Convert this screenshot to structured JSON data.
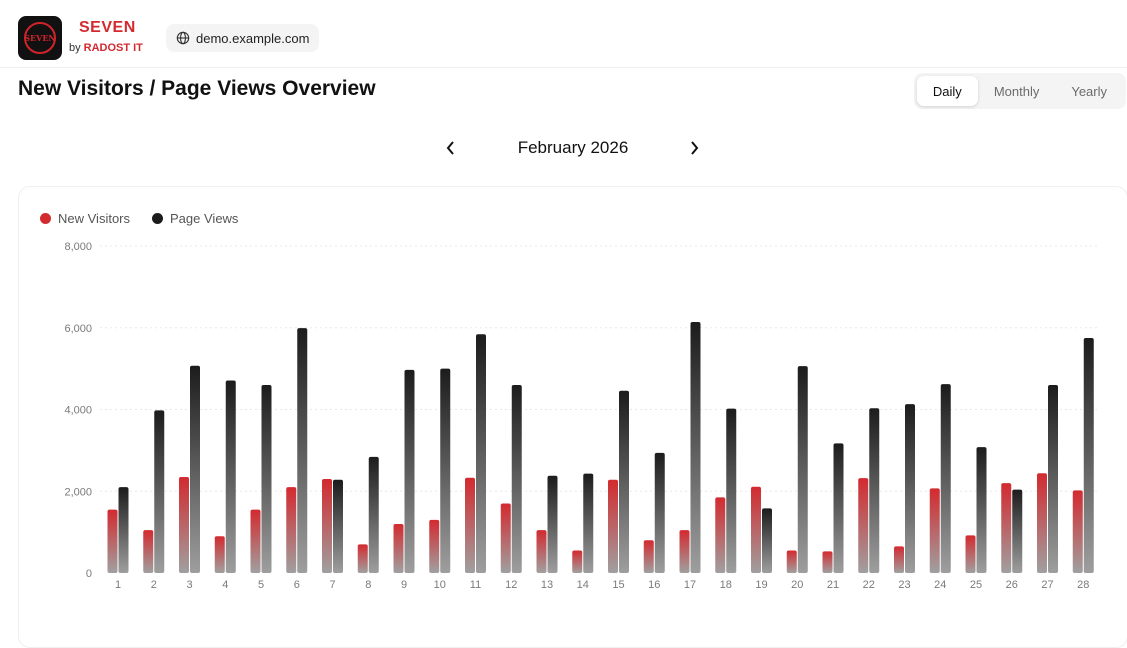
{
  "header": {
    "brand_name": "SEVEN",
    "brand_by": "by",
    "brand_company": "RADOST IT",
    "logo_text": "SEVEN",
    "domain": "demo.example.com"
  },
  "page": {
    "title": "New Visitors / Page Views Overview",
    "tabs": [
      {
        "label": "Daily",
        "active": true
      },
      {
        "label": "Monthly",
        "active": false
      },
      {
        "label": "Yearly",
        "active": false
      }
    ],
    "period": "February 2026",
    "prev_icon": "chevron-left-icon",
    "next_icon": "chevron-right-icon"
  },
  "colors": {
    "visitors": "#d32a2f",
    "views": "#1c1c1c",
    "grid": "#e8e8e8",
    "tick": "#7a7a7a"
  },
  "chart_data": {
    "type": "bar",
    "categories": [
      "1",
      "2",
      "3",
      "4",
      "5",
      "6",
      "7",
      "8",
      "9",
      "10",
      "11",
      "12",
      "13",
      "14",
      "15",
      "16",
      "17",
      "18",
      "19",
      "20",
      "21",
      "22",
      "23",
      "24",
      "25",
      "26",
      "27",
      "28"
    ],
    "series": [
      {
        "name": "New Visitors",
        "values": [
          1550,
          1050,
          2350,
          900,
          1550,
          2100,
          2300,
          700,
          1200,
          1300,
          2330,
          1700,
          1050,
          550,
          2280,
          800,
          1050,
          1850,
          2110,
          550,
          530,
          2320,
          650,
          2070,
          920,
          2200,
          2440,
          2020
        ]
      },
      {
        "name": "Page Views",
        "values": [
          2100,
          3980,
          5070,
          4710,
          4600,
          5990,
          2280,
          2840,
          4970,
          5000,
          5840,
          4600,
          2380,
          2430,
          4460,
          2940,
          6140,
          4020,
          1580,
          5060,
          3170,
          4030,
          4130,
          4620,
          3080,
          2040,
          4600,
          5750
        ]
      }
    ],
    "ylim": [
      0,
      8000
    ],
    "yticks": [
      "0",
      "2,000",
      "4,000",
      "6,000",
      "8,000"
    ],
    "ytick_values": [
      0,
      2000,
      4000,
      6000,
      8000
    ],
    "grid": true,
    "legend": "top-left"
  }
}
